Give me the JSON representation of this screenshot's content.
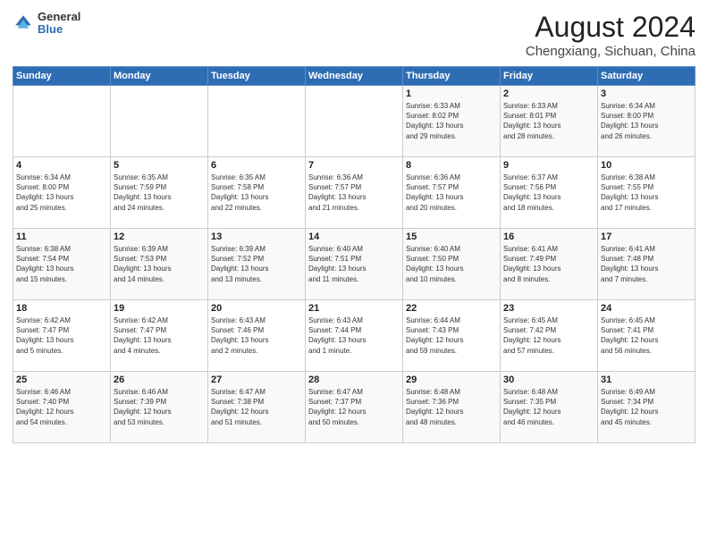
{
  "header": {
    "logo_general": "General",
    "logo_blue": "Blue",
    "month": "August 2024",
    "location": "Chengxiang, Sichuan, China"
  },
  "weekdays": [
    "Sunday",
    "Monday",
    "Tuesday",
    "Wednesday",
    "Thursday",
    "Friday",
    "Saturday"
  ],
  "weeks": [
    [
      {
        "day": "",
        "info": ""
      },
      {
        "day": "",
        "info": ""
      },
      {
        "day": "",
        "info": ""
      },
      {
        "day": "",
        "info": ""
      },
      {
        "day": "1",
        "info": "Sunrise: 6:33 AM\nSunset: 8:02 PM\nDaylight: 13 hours\nand 29 minutes."
      },
      {
        "day": "2",
        "info": "Sunrise: 6:33 AM\nSunset: 8:01 PM\nDaylight: 13 hours\nand 28 minutes."
      },
      {
        "day": "3",
        "info": "Sunrise: 6:34 AM\nSunset: 8:00 PM\nDaylight: 13 hours\nand 26 minutes."
      }
    ],
    [
      {
        "day": "4",
        "info": "Sunrise: 6:34 AM\nSunset: 8:00 PM\nDaylight: 13 hours\nand 25 minutes."
      },
      {
        "day": "5",
        "info": "Sunrise: 6:35 AM\nSunset: 7:59 PM\nDaylight: 13 hours\nand 24 minutes."
      },
      {
        "day": "6",
        "info": "Sunrise: 6:35 AM\nSunset: 7:58 PM\nDaylight: 13 hours\nand 22 minutes."
      },
      {
        "day": "7",
        "info": "Sunrise: 6:36 AM\nSunset: 7:57 PM\nDaylight: 13 hours\nand 21 minutes."
      },
      {
        "day": "8",
        "info": "Sunrise: 6:36 AM\nSunset: 7:57 PM\nDaylight: 13 hours\nand 20 minutes."
      },
      {
        "day": "9",
        "info": "Sunrise: 6:37 AM\nSunset: 7:56 PM\nDaylight: 13 hours\nand 18 minutes."
      },
      {
        "day": "10",
        "info": "Sunrise: 6:38 AM\nSunset: 7:55 PM\nDaylight: 13 hours\nand 17 minutes."
      }
    ],
    [
      {
        "day": "11",
        "info": "Sunrise: 6:38 AM\nSunset: 7:54 PM\nDaylight: 13 hours\nand 15 minutes."
      },
      {
        "day": "12",
        "info": "Sunrise: 6:39 AM\nSunset: 7:53 PM\nDaylight: 13 hours\nand 14 minutes."
      },
      {
        "day": "13",
        "info": "Sunrise: 6:39 AM\nSunset: 7:52 PM\nDaylight: 13 hours\nand 13 minutes."
      },
      {
        "day": "14",
        "info": "Sunrise: 6:40 AM\nSunset: 7:51 PM\nDaylight: 13 hours\nand 11 minutes."
      },
      {
        "day": "15",
        "info": "Sunrise: 6:40 AM\nSunset: 7:50 PM\nDaylight: 13 hours\nand 10 minutes."
      },
      {
        "day": "16",
        "info": "Sunrise: 6:41 AM\nSunset: 7:49 PM\nDaylight: 13 hours\nand 8 minutes."
      },
      {
        "day": "17",
        "info": "Sunrise: 6:41 AM\nSunset: 7:48 PM\nDaylight: 13 hours\nand 7 minutes."
      }
    ],
    [
      {
        "day": "18",
        "info": "Sunrise: 6:42 AM\nSunset: 7:47 PM\nDaylight: 13 hours\nand 5 minutes."
      },
      {
        "day": "19",
        "info": "Sunrise: 6:42 AM\nSunset: 7:47 PM\nDaylight: 13 hours\nand 4 minutes."
      },
      {
        "day": "20",
        "info": "Sunrise: 6:43 AM\nSunset: 7:46 PM\nDaylight: 13 hours\nand 2 minutes."
      },
      {
        "day": "21",
        "info": "Sunrise: 6:43 AM\nSunset: 7:44 PM\nDaylight: 13 hours\nand 1 minute."
      },
      {
        "day": "22",
        "info": "Sunrise: 6:44 AM\nSunset: 7:43 PM\nDaylight: 12 hours\nand 59 minutes."
      },
      {
        "day": "23",
        "info": "Sunrise: 6:45 AM\nSunset: 7:42 PM\nDaylight: 12 hours\nand 57 minutes."
      },
      {
        "day": "24",
        "info": "Sunrise: 6:45 AM\nSunset: 7:41 PM\nDaylight: 12 hours\nand 56 minutes."
      }
    ],
    [
      {
        "day": "25",
        "info": "Sunrise: 6:46 AM\nSunset: 7:40 PM\nDaylight: 12 hours\nand 54 minutes."
      },
      {
        "day": "26",
        "info": "Sunrise: 6:46 AM\nSunset: 7:39 PM\nDaylight: 12 hours\nand 53 minutes."
      },
      {
        "day": "27",
        "info": "Sunrise: 6:47 AM\nSunset: 7:38 PM\nDaylight: 12 hours\nand 51 minutes."
      },
      {
        "day": "28",
        "info": "Sunrise: 6:47 AM\nSunset: 7:37 PM\nDaylight: 12 hours\nand 50 minutes."
      },
      {
        "day": "29",
        "info": "Sunrise: 6:48 AM\nSunset: 7:36 PM\nDaylight: 12 hours\nand 48 minutes."
      },
      {
        "day": "30",
        "info": "Sunrise: 6:48 AM\nSunset: 7:35 PM\nDaylight: 12 hours\nand 46 minutes."
      },
      {
        "day": "31",
        "info": "Sunrise: 6:49 AM\nSunset: 7:34 PM\nDaylight: 12 hours\nand 45 minutes."
      }
    ]
  ]
}
